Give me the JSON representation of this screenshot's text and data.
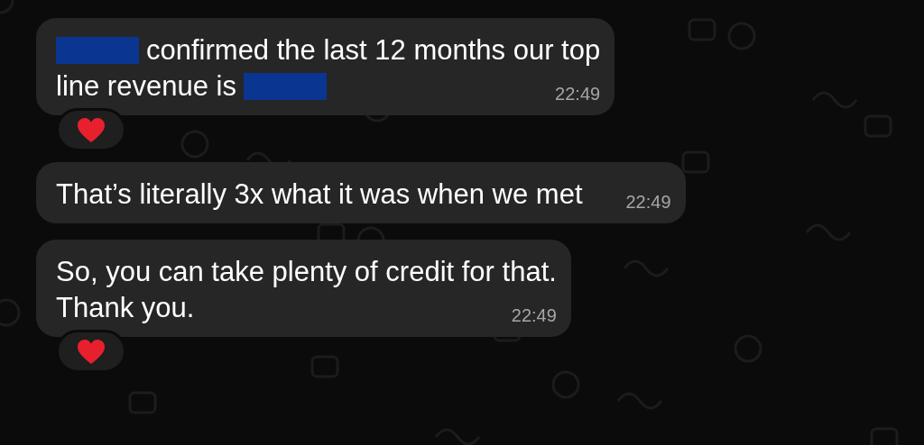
{
  "messages": [
    {
      "lines": [
        [
          {
            "kind": "redaction"
          },
          {
            "kind": "text",
            "text": "confirmed the last 12 months our top"
          }
        ],
        [
          {
            "kind": "text",
            "text": "line revenue is"
          },
          {
            "kind": "redaction"
          }
        ]
      ],
      "time": "22:49",
      "hearted": true
    },
    {
      "lines": [
        [
          {
            "kind": "text",
            "text": "That’s literally 3x what it was when we met"
          }
        ]
      ],
      "time": "22:49",
      "hearted": false
    },
    {
      "lines": [
        [
          {
            "kind": "text",
            "text": "So, you can take plenty of credit for that."
          }
        ],
        [
          {
            "kind": "text",
            "text": "Thank you."
          }
        ]
      ],
      "time": "22:49",
      "hearted": true
    }
  ]
}
